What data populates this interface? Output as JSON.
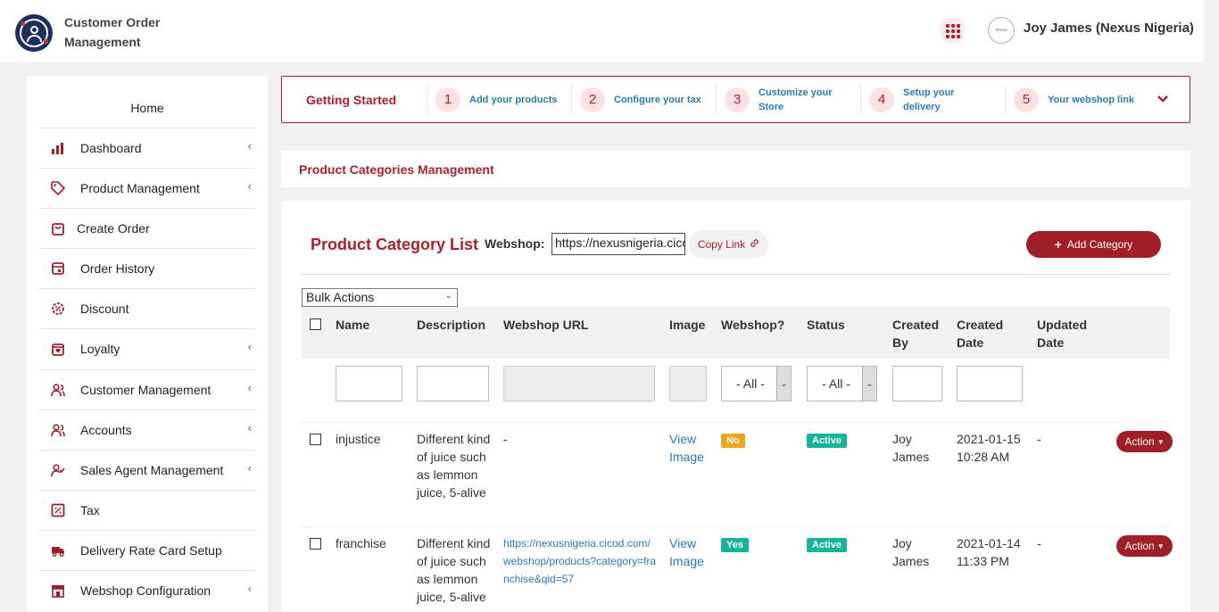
{
  "app": {
    "title": "Customer Order Management"
  },
  "header": {
    "user_name": "Joy James (Nexus Nigeria)",
    "avatar_text": "nexus"
  },
  "sidebar": {
    "home": "Home",
    "items": [
      {
        "label": "Dashboard",
        "icon": "bar-chart-icon",
        "has_children": true
      },
      {
        "label": "Product Management",
        "icon": "tag-icon",
        "has_children": true
      },
      {
        "label": "Create Order",
        "icon": "cart-icon",
        "has_children": false
      },
      {
        "label": "Order History",
        "icon": "history-icon",
        "has_children": false
      },
      {
        "label": "Discount",
        "icon": "discount-icon",
        "has_children": false
      },
      {
        "label": "Loyalty",
        "icon": "loyalty-icon",
        "has_children": true
      },
      {
        "label": "Customer Management",
        "icon": "users-icon",
        "has_children": true
      },
      {
        "label": "Accounts",
        "icon": "users-icon",
        "has_children": true
      },
      {
        "label": "Sales Agent Management",
        "icon": "agent-icon",
        "has_children": true
      },
      {
        "label": "Tax",
        "icon": "percent-icon",
        "has_children": false
      },
      {
        "label": "Delivery Rate Card Setup",
        "icon": "truck-icon",
        "has_children": false
      },
      {
        "label": "Webshop Configuration",
        "icon": "store-icon",
        "has_children": true
      }
    ]
  },
  "getting_started": {
    "title": "Getting Started",
    "steps": [
      {
        "num": "1",
        "label": "Add your products"
      },
      {
        "num": "2",
        "label": "Configure your tax"
      },
      {
        "num": "3",
        "label": "Customize your Store"
      },
      {
        "num": "4",
        "label": "Setup your delivery"
      },
      {
        "num": "5",
        "label": "Your webshop link"
      }
    ]
  },
  "page": {
    "title": "Product Categories Management"
  },
  "list": {
    "title": "Product Category List",
    "webshop_label": "Webshop:",
    "webshop_url": "https://nexusnigeria.cicod.com/webshop",
    "copy_link": "Copy Link",
    "add_category": "Add Category",
    "bulk_actions": "Bulk Actions",
    "columns": [
      "Name",
      "Description",
      "Webshop URL",
      "Image",
      "Webshop?",
      "Status",
      "Created By",
      "Created Date",
      "Updated Date"
    ],
    "filter_all": "- All -",
    "rows": [
      {
        "name": "injustice",
        "description": "Different kind of juice such as lemmon juice, 5-alive",
        "webshop_url": "-",
        "image": "View Image",
        "webshop": "No",
        "status": "Active",
        "created_by": "Joy James",
        "created_date": "2021-01-15 10:28 AM",
        "updated_date": "-",
        "action": "Action"
      },
      {
        "name": "franchise",
        "description": "Different kind of juice such as lemmon juice, 5-alive",
        "webshop_url": "https://nexusnigeria.cicod.com/webshop/products?category=franchise&qid=57",
        "image": "View Image",
        "webshop": "Yes",
        "status": "Active",
        "created_by": "Joy James",
        "created_date": "2021-01-14 11:33 PM",
        "updated_date": "-",
        "action": "Action"
      }
    ]
  },
  "colors": {
    "brand": "#a01e27",
    "link": "#2a7ab8",
    "badge_no": "#f0a41c",
    "badge_yes": "#17b39a"
  }
}
